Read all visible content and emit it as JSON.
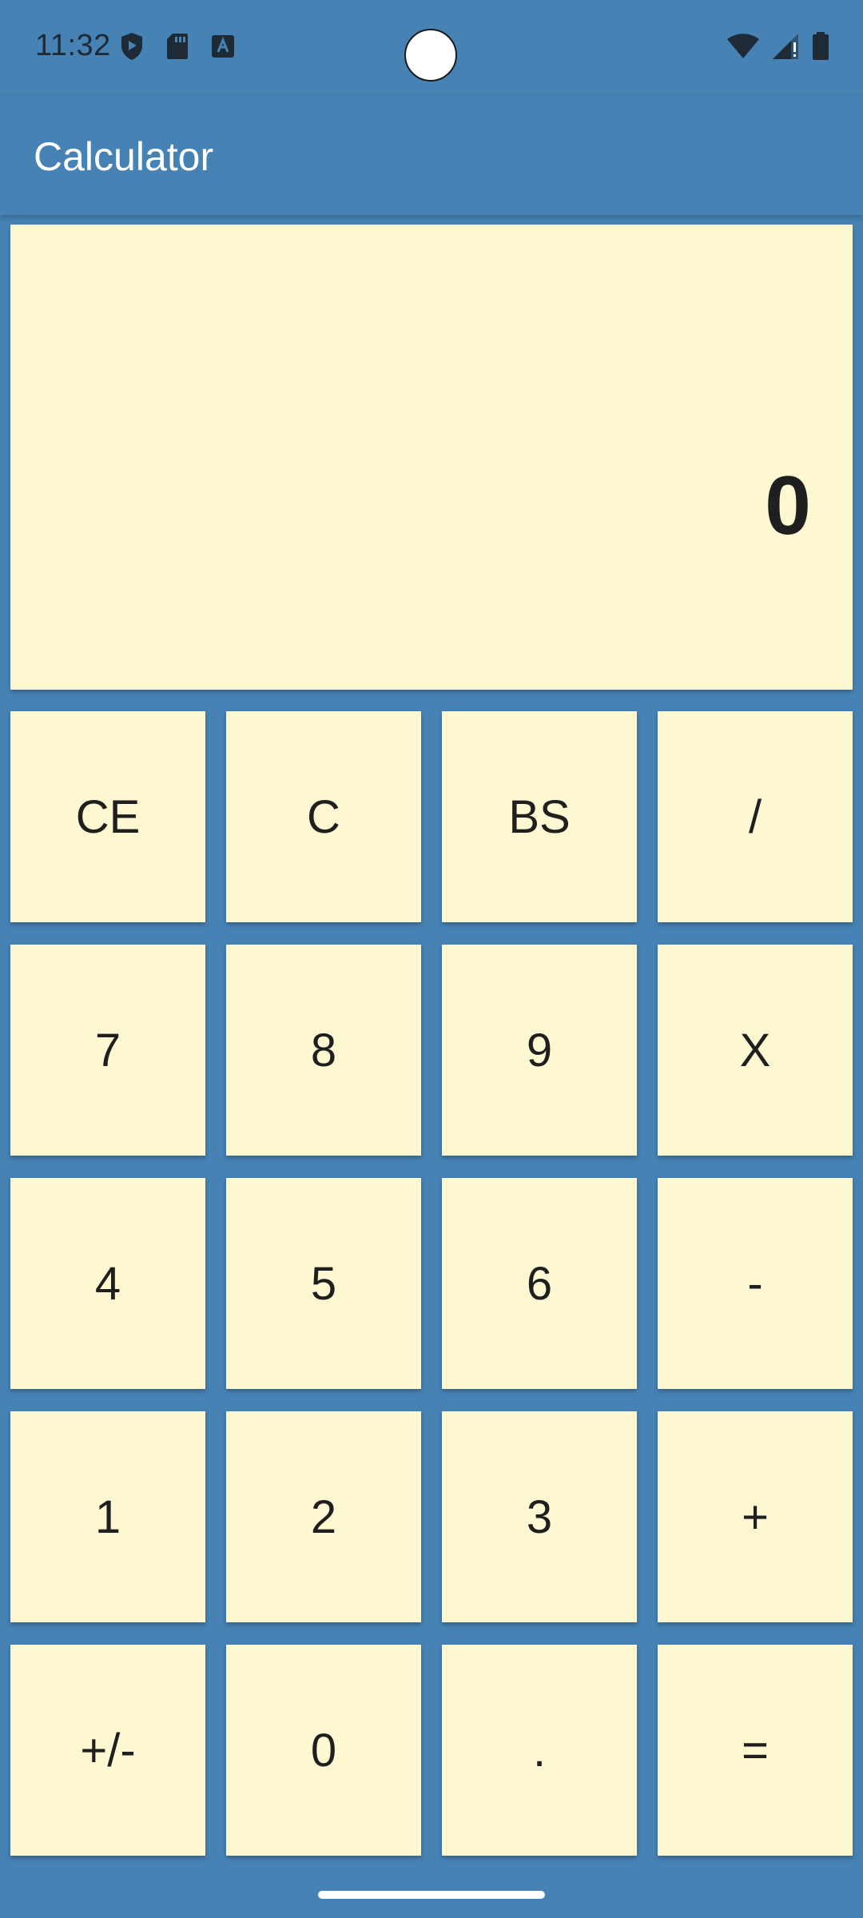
{
  "status_bar": {
    "time": "11:32",
    "left_icons": [
      "shield-play-icon",
      "sd-card-icon",
      "text-a-icon"
    ],
    "right_icons": [
      "wifi-icon",
      "cell-signal-icon",
      "battery-icon"
    ]
  },
  "app_bar": {
    "title": "Calculator"
  },
  "display": {
    "value": "0"
  },
  "keypad": {
    "keys": [
      "CE",
      "C",
      "BS",
      "/",
      "7",
      "8",
      "9",
      "X",
      "4",
      "5",
      "6",
      "-",
      "1",
      "2",
      "3",
      "+",
      "+/-",
      "0",
      ".",
      "="
    ]
  },
  "colors": {
    "background": "#4682b4",
    "panel": "#fdf8d2",
    "text": "#1f1f1f",
    "title_text": "#ffffff"
  }
}
